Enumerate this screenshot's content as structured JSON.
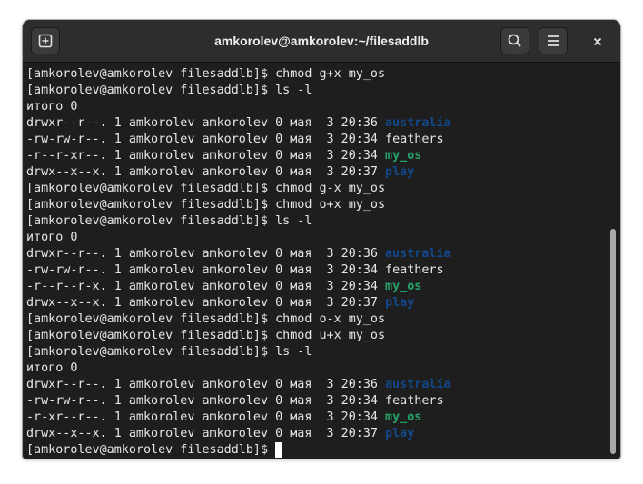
{
  "window": {
    "title": "amkorolev@amkorolev:~/filesaddlb"
  },
  "icons": {
    "new_tab": "new-tab-icon",
    "search": "search-icon",
    "menu": "hamburger-menu-icon",
    "close": "close-icon"
  },
  "colors": {
    "background": "#1e1e1e",
    "foreground": "#e6e6e6",
    "directory": "#12488b",
    "executable": "#26a269",
    "headerbar": "#2d2d2d"
  },
  "terminal": {
    "lines": [
      [
        {
          "t": "[amkorolev@amkorolev filesaddlb]$ chmod g+x my_os",
          "c": "text"
        }
      ],
      [
        {
          "t": "[amkorolev@amkorolev filesaddlb]$ ls -l",
          "c": "text"
        }
      ],
      [
        {
          "t": "итого 0",
          "c": "text"
        }
      ],
      [
        {
          "t": "drwxr--r--. 1 amkorolev amkorolev 0 мая  3 20:36 ",
          "c": "text"
        },
        {
          "t": "australia",
          "c": "dir"
        }
      ],
      [
        {
          "t": "-rw-rw-r--. 1 amkorolev amkorolev 0 мая  3 20:34 feathers",
          "c": "text"
        }
      ],
      [
        {
          "t": "-r--r-xr--. 1 amkorolev amkorolev 0 мая  3 20:34 ",
          "c": "text"
        },
        {
          "t": "my_os",
          "c": "exec"
        }
      ],
      [
        {
          "t": "drwx--x--x. 1 amkorolev amkorolev 0 мая  3 20:37 ",
          "c": "text"
        },
        {
          "t": "play",
          "c": "dir"
        }
      ],
      [
        {
          "t": "[amkorolev@amkorolev filesaddlb]$ chmod g-x my_os",
          "c": "text"
        }
      ],
      [
        {
          "t": "[amkorolev@amkorolev filesaddlb]$ chmod o+x my_os",
          "c": "text"
        }
      ],
      [
        {
          "t": "[amkorolev@amkorolev filesaddlb]$ ls -l",
          "c": "text"
        }
      ],
      [
        {
          "t": "итого 0",
          "c": "text"
        }
      ],
      [
        {
          "t": "drwxr--r--. 1 amkorolev amkorolev 0 мая  3 20:36 ",
          "c": "text"
        },
        {
          "t": "australia",
          "c": "dir"
        }
      ],
      [
        {
          "t": "-rw-rw-r--. 1 amkorolev amkorolev 0 мая  3 20:34 feathers",
          "c": "text"
        }
      ],
      [
        {
          "t": "-r--r--r-x. 1 amkorolev amkorolev 0 мая  3 20:34 ",
          "c": "text"
        },
        {
          "t": "my_os",
          "c": "exec"
        }
      ],
      [
        {
          "t": "drwx--x--x. 1 amkorolev amkorolev 0 мая  3 20:37 ",
          "c": "text"
        },
        {
          "t": "play",
          "c": "dir"
        }
      ],
      [
        {
          "t": "[amkorolev@amkorolev filesaddlb]$ chmod o-x my_os",
          "c": "text"
        }
      ],
      [
        {
          "t": "[amkorolev@amkorolev filesaddlb]$ chmod u+x my_os",
          "c": "text"
        }
      ],
      [
        {
          "t": "[amkorolev@amkorolev filesaddlb]$ ls -l",
          "c": "text"
        }
      ],
      [
        {
          "t": "итого 0",
          "c": "text"
        }
      ],
      [
        {
          "t": "drwxr--r--. 1 amkorolev amkorolev 0 мая  3 20:36 ",
          "c": "text"
        },
        {
          "t": "australia",
          "c": "dir"
        }
      ],
      [
        {
          "t": "-rw-rw-r--. 1 amkorolev amkorolev 0 мая  3 20:34 feathers",
          "c": "text"
        }
      ],
      [
        {
          "t": "-r-xr--r--. 1 amkorolev amkorolev 0 мая  3 20:34 ",
          "c": "text"
        },
        {
          "t": "my_os",
          "c": "exec"
        }
      ],
      [
        {
          "t": "drwx--x--x. 1 amkorolev amkorolev 0 мая  3 20:37 ",
          "c": "text"
        },
        {
          "t": "play",
          "c": "dir"
        }
      ],
      [
        {
          "t": "[amkorolev@amkorolev filesaddlb]$ ",
          "c": "text"
        },
        {
          "t": "",
          "c": "cursor"
        }
      ]
    ]
  }
}
